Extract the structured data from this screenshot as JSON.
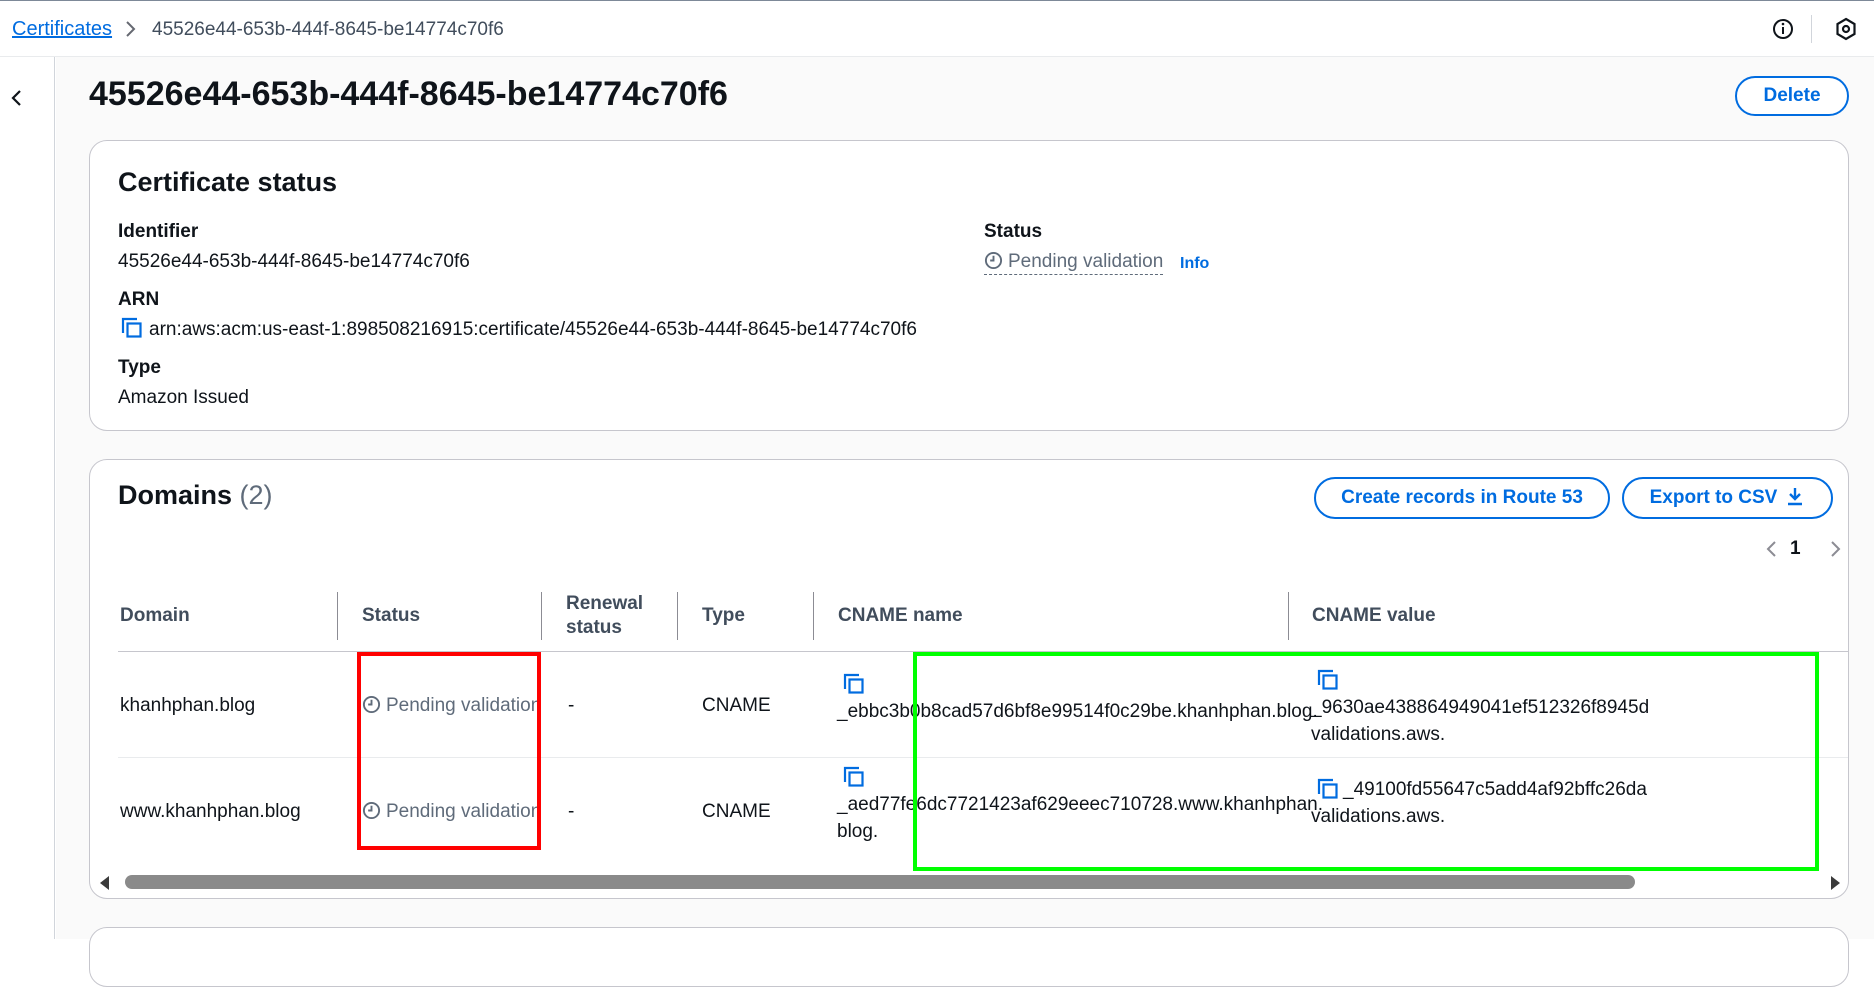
{
  "breadcrumb": {
    "root": "Certificates",
    "separator": ">",
    "current": "45526e44-653b-444f-8645-be14774c70f6"
  },
  "icons": {
    "info": "info-circle-icon",
    "settings": "hexagon-settings-icon",
    "back": "chevron-left-icon",
    "copy": "copy-icon",
    "pending": "clock-icon",
    "export": "download-icon"
  },
  "colors": {
    "accent": "#006ce0",
    "pending_text": "#5f6b7a",
    "highlight_red": "#ff0000",
    "highlight_green": "#00ff00"
  },
  "page": {
    "title": "45526e44-653b-444f-8645-be14774c70f6",
    "delete_label": "Delete"
  },
  "status_card": {
    "title": "Certificate status",
    "identifier_label": "Identifier",
    "identifier_value": "45526e44-653b-444f-8645-be14774c70f6",
    "arn_label": "ARN",
    "arn_value": "arn:aws:acm:us-east-1:898508216915:certificate/45526e44-653b-444f-8645-be14774c70f6",
    "type_label": "Type",
    "type_value": "Amazon Issued",
    "status_label": "Status",
    "status_value": "Pending validation",
    "info_label": "Info"
  },
  "domains": {
    "title": "Domains",
    "count": "(2)",
    "create_records_label": "Create records in Route 53",
    "export_label": "Export to CSV",
    "page_number": "1",
    "columns": {
      "domain": "Domain",
      "status": "Status",
      "renewal_line1": "Renewal",
      "renewal_line2": "status",
      "type": "Type",
      "cname_name": "CNAME name",
      "cname_value": "CNAME value"
    },
    "rows": [
      {
        "domain": "khanhphan.blog",
        "status": "Pending validation",
        "renewal": "-",
        "type": "CNAME",
        "cname_name_line1": "_ebbc3b0b8cad57d6bf8e99514f0c29be.khanhphan.blog.",
        "cname_name_line2": "",
        "cname_value_line1": "_9630ae438864949041ef512326f8945d",
        "cname_value_line2": "validations.aws."
      },
      {
        "domain": "www.khanhphan.blog",
        "status": "Pending validation",
        "renewal": "-",
        "type": "CNAME",
        "cname_name_line1": "_aed77fe6dc7721423af629eeec710728.www.khanhphan.",
        "cname_name_line2": "blog.",
        "cname_value_line1": "_49100fd55647c5add4af92bffc26da",
        "cname_value_line2": "validations.aws."
      }
    ]
  }
}
